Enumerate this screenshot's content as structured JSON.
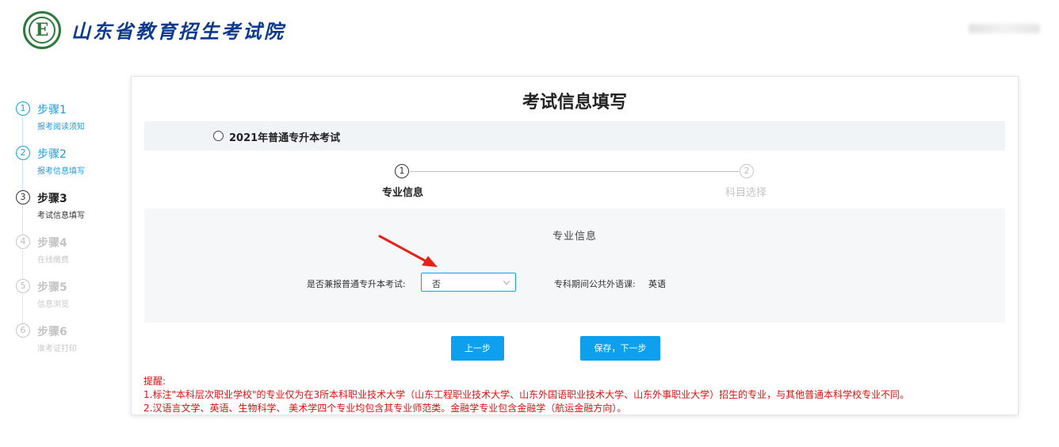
{
  "header": {
    "logo_letter": "E",
    "site_title": "山东省教育招生考试院"
  },
  "sidebar": {
    "steps": [
      {
        "number": "1",
        "title": "步骤1",
        "subtitle": "报考阅读须知",
        "state": "done"
      },
      {
        "number": "2",
        "title": "步骤2",
        "subtitle": "报考信息填写",
        "state": "done"
      },
      {
        "number": "3",
        "title": "步骤3",
        "subtitle": "考试信息填写",
        "state": "current"
      },
      {
        "number": "4",
        "title": "步骤4",
        "subtitle": "在线缴费",
        "state": "pending"
      },
      {
        "number": "5",
        "title": "步骤5",
        "subtitle": "信息浏览",
        "state": "pending"
      },
      {
        "number": "6",
        "title": "步骤6",
        "subtitle": "准考证打印",
        "state": "pending"
      }
    ]
  },
  "main": {
    "title": "考试信息填写",
    "exam_option": "2021年普通专升本考试",
    "substeps": [
      {
        "number": "1",
        "label": "专业信息",
        "state": "current"
      },
      {
        "number": "2",
        "label": "科目选择",
        "state": "pending"
      }
    ],
    "panel": {
      "title": "专业信息",
      "concurrent_label": "是否兼报普通专升本考试:",
      "concurrent_value": "否",
      "language_label": "专科期间公共外语课:",
      "language_value": "英语"
    },
    "buttons": {
      "prev": "上一步",
      "save_next": "保存，下一步"
    },
    "reminder": {
      "heading": "提醒:",
      "lines": [
        "1.标注\"本科层次职业学校\"的专业仅为在3所本科职业技术大学（山东工程职业技术大学、山东外国语职业技术大学、山东外事职业大学）招生的专业，与其他普通本科学校专业不同。",
        "2.汉语言文学、英语、生物科学、 美术学四个专业均包含其专业师范类。金融学专业包含金融学（航运金融方向）。"
      ]
    }
  },
  "colors": {
    "accent": "#0ea0ee",
    "step_blue": "#1a9ee0",
    "title_blue": "#0c3a8f",
    "warning_red": "#e01010",
    "annotation_red": "#e8201a"
  }
}
